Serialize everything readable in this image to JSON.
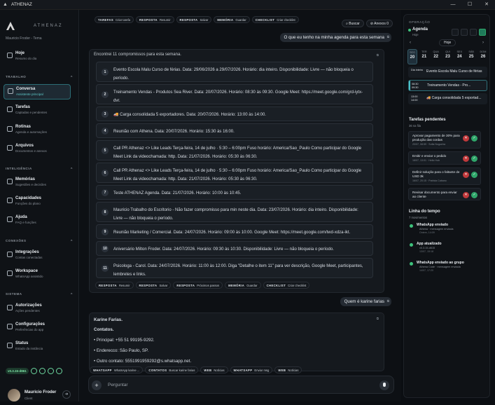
{
  "window": {
    "title": "ATHENAZ",
    "controls": [
      "—",
      "☐",
      "✕"
    ]
  },
  "sidebar": {
    "brand": "ATHENAZ",
    "user_context": "Mauricio Froder - Tema",
    "sections": {
      "trabalho": "TRABALHO",
      "inteligencia": "INTELIGÊNCIA",
      "conexoes": "CONEXÕES",
      "sistema": "SISTEMA"
    },
    "items": [
      {
        "label": "Hoje",
        "sub": "Resumo do dia"
      },
      {
        "label": "Conversa",
        "sub": "Assistente principal"
      },
      {
        "label": "Tarefas",
        "sub": "Captadas e pendentes"
      },
      {
        "label": "Rotinas",
        "sub": "Agenda e automações"
      },
      {
        "label": "Arquivos",
        "sub": "Documentos e anexos"
      },
      {
        "label": "Memórias",
        "sub": "Sugestões e decisões"
      },
      {
        "label": "Capacidades",
        "sub": "Funções do plano"
      },
      {
        "label": "Ajuda",
        "sub": "FAQ e funções"
      },
      {
        "label": "Integrações",
        "sub": "Contas conectadas"
      },
      {
        "label": "Workspace",
        "sub": "WhatsApp assistido"
      },
      {
        "label": "Autorizações",
        "sub": "Ações pendentes"
      },
      {
        "label": "Configurações",
        "sub": "Preferências do app"
      },
      {
        "label": "Status",
        "sub": "Estado da instância"
      }
    ],
    "version": "v0.3.15-d861",
    "user": {
      "name": "Mauricio Froder",
      "role": "Client"
    }
  },
  "main": {
    "top_chips": [
      {
        "tag": "TAREFAS",
        "text": "Criar tarefa"
      },
      {
        "tag": "RESPOSTA",
        "text": "Resumir"
      },
      {
        "tag": "RESPOSTA",
        "text": "Salvar"
      },
      {
        "tag": "MEMÓRIA",
        "text": "Guardar"
      },
      {
        "tag": "CHECKLIST",
        "text": "Criar checklist"
      }
    ],
    "search_label": "Buscar",
    "attach_label": "Anexos",
    "attach_count": "0",
    "q1": "O que eu tenho na minha agenda para esta semana",
    "answer1_caption": "Encontrei 11 compromissos para esta semana.",
    "events": [
      "Evento Escola Malu Curso de férias. Data: 29/06/2026 a 29/07/2026. Horário: dia inteiro. Disponibilidade: Livre — não bloqueia o período.",
      "Treinamento Vendas - Produtos Sea River. Data: 20/07/2026. Horário: 08:30 às 09:30. Google Meet: https://meet.google.com/grd-iytx-dvr.",
      "🚚 Carga consolidada 5 exportadores. Data: 20/07/2026. Horário: 13:00 às 14:00.",
      "Reunião com Athena. Data: 20/07/2026. Horário: 15:30 às 16:00.",
      "Call PR Athenaz <> Like Leads Terça-feira, 14 de julho · 5:30 – 6:00pm Fuso horário: America/Sao_Paulo Como participar do Google Meet Link da videochamada: http. Data: 21/07/2026. Horário: 05:30 às 06:30.",
      "Call PR Athenaz <> Like Leads Terça-feira, 14 de julho · 5:30 – 6:00pm Fuso horário: America/Sao_Paulo Como participar do Google Meet Link da videochamada: http. Data: 21/07/2026. Horário: 05:30 às 06:30.",
      "Teste ATHENAZ Agenda. Data: 21/07/2026. Horário: 10:00 às 10:45.",
      "Mauricio Trabalho do Escritorio - Não fazer compromisso para min neste dia. Data: 23/07/2026. Horário: dia inteiro. Disponibilidade: Livre — não bloqueia o período.",
      "Reunião Marketing / Comercial. Data: 24/07/2026. Horário: 09:00 às 10:00. Google Meet: https://meet.google.com/twd-xdza-ikt.",
      "Aniversário Milton Froder. Data: 24/07/2026. Horário: 09:30 às 10:30. Disponibilidade: Livre — não bloqueia o período.",
      "Psicologa - Carol. Data: 24/07/2026. Horário: 11:00 às 12:00. Diga \"Detalhe o item 11\" para ver descrição, Google Meet, participantes, lembretes e links."
    ],
    "answer1_chips": [
      {
        "tag": "RESPOSTA",
        "text": "Resumir"
      },
      {
        "tag": "RESPOSTA",
        "text": "Salvar"
      },
      {
        "tag": "RESPOSTA",
        "text": "Próximos passos"
      },
      {
        "tag": "MEMÓRIA",
        "text": "Guardar"
      },
      {
        "tag": "CHECKLIST",
        "text": "Criar checklist"
      }
    ],
    "q2": "Quem é karine farias",
    "answer2": {
      "name": "Karine Farias.",
      "heading": "Contatos.",
      "lines": [
        "Principal: +55 51 99195-9292.",
        "Enderecco: São Paulo, SP.",
        "Outro contato: 5551991959292@s.whatsapp.net."
      ]
    },
    "bottom_chips": [
      {
        "tag": "WHATSAPP",
        "text": "WhatsApp karine ..."
      },
      {
        "tag": "CONTATOS",
        "text": "Buscar karine farias"
      },
      {
        "tag": "WEB",
        "text": "Notícias"
      },
      {
        "tag": "WHATSAPP",
        "text": "Enviar msg"
      },
      {
        "tag": "WEB",
        "text": "Notícias"
      }
    ],
    "input_placeholder": "Perguntar"
  },
  "right": {
    "caption": "OPERAÇÃO",
    "agenda_title": "Agenda",
    "agenda_sub": "Hoje",
    "today_btn": "Hoje",
    "days": [
      {
        "n": "SEG",
        "d": "20"
      },
      {
        "n": "TER",
        "d": "21"
      },
      {
        "n": "QUA",
        "d": "22"
      },
      {
        "n": "QUI",
        "d": "23"
      },
      {
        "n": "SEX",
        "d": "24"
      },
      {
        "n": "SÁB",
        "d": "25"
      },
      {
        "n": "DOM",
        "d": "26"
      }
    ],
    "schedule": [
      {
        "time": "Dia inteiro",
        "title": "Evento Escola Malu Curso de férias"
      },
      {
        "time": "08:30 09:30",
        "title": "Treinamento Vendas - Pro..."
      },
      {
        "time": "13:00 14:00",
        "title": "🚚 Carga consolidada 5 exportad..."
      }
    ],
    "tasks_title": "Tarefas pendentes",
    "tasks_sub": "36 na fila",
    "tasks": [
      {
        "t": "Aprovar pagamento de 30% para produção das cordas",
        "m": "20/07, 08:59 · Sofia Nogueira"
      },
      {
        "t": "Emitir e enviar o pedido",
        "m": "18/07, 13:01 · Hello Hub"
      },
      {
        "t": "Definir solução para o faltante de USD 3k",
        "m": "16/07, 20:15 · Patricia Cabano"
      },
      {
        "t": "Revisar documento para enviar ao cliente",
        "m": ""
      }
    ],
    "timeline_title": "Linha do tempo",
    "timeline_sub": "7 movimentos",
    "timeline": [
      {
        "t": "WhatsApp enviado",
        "s": "Athena · mensagem enviada",
        "d": "Ontem, 14:09"
      },
      {
        "t": "App atualizado",
        "s": "v0.3.15-d615",
        "d": "13/07, 15:18"
      },
      {
        "t": "WhatsApp enviado ao grupo",
        "s": "Athena Code · mensagem enviada",
        "d": "14/07, 17:20"
      }
    ]
  }
}
